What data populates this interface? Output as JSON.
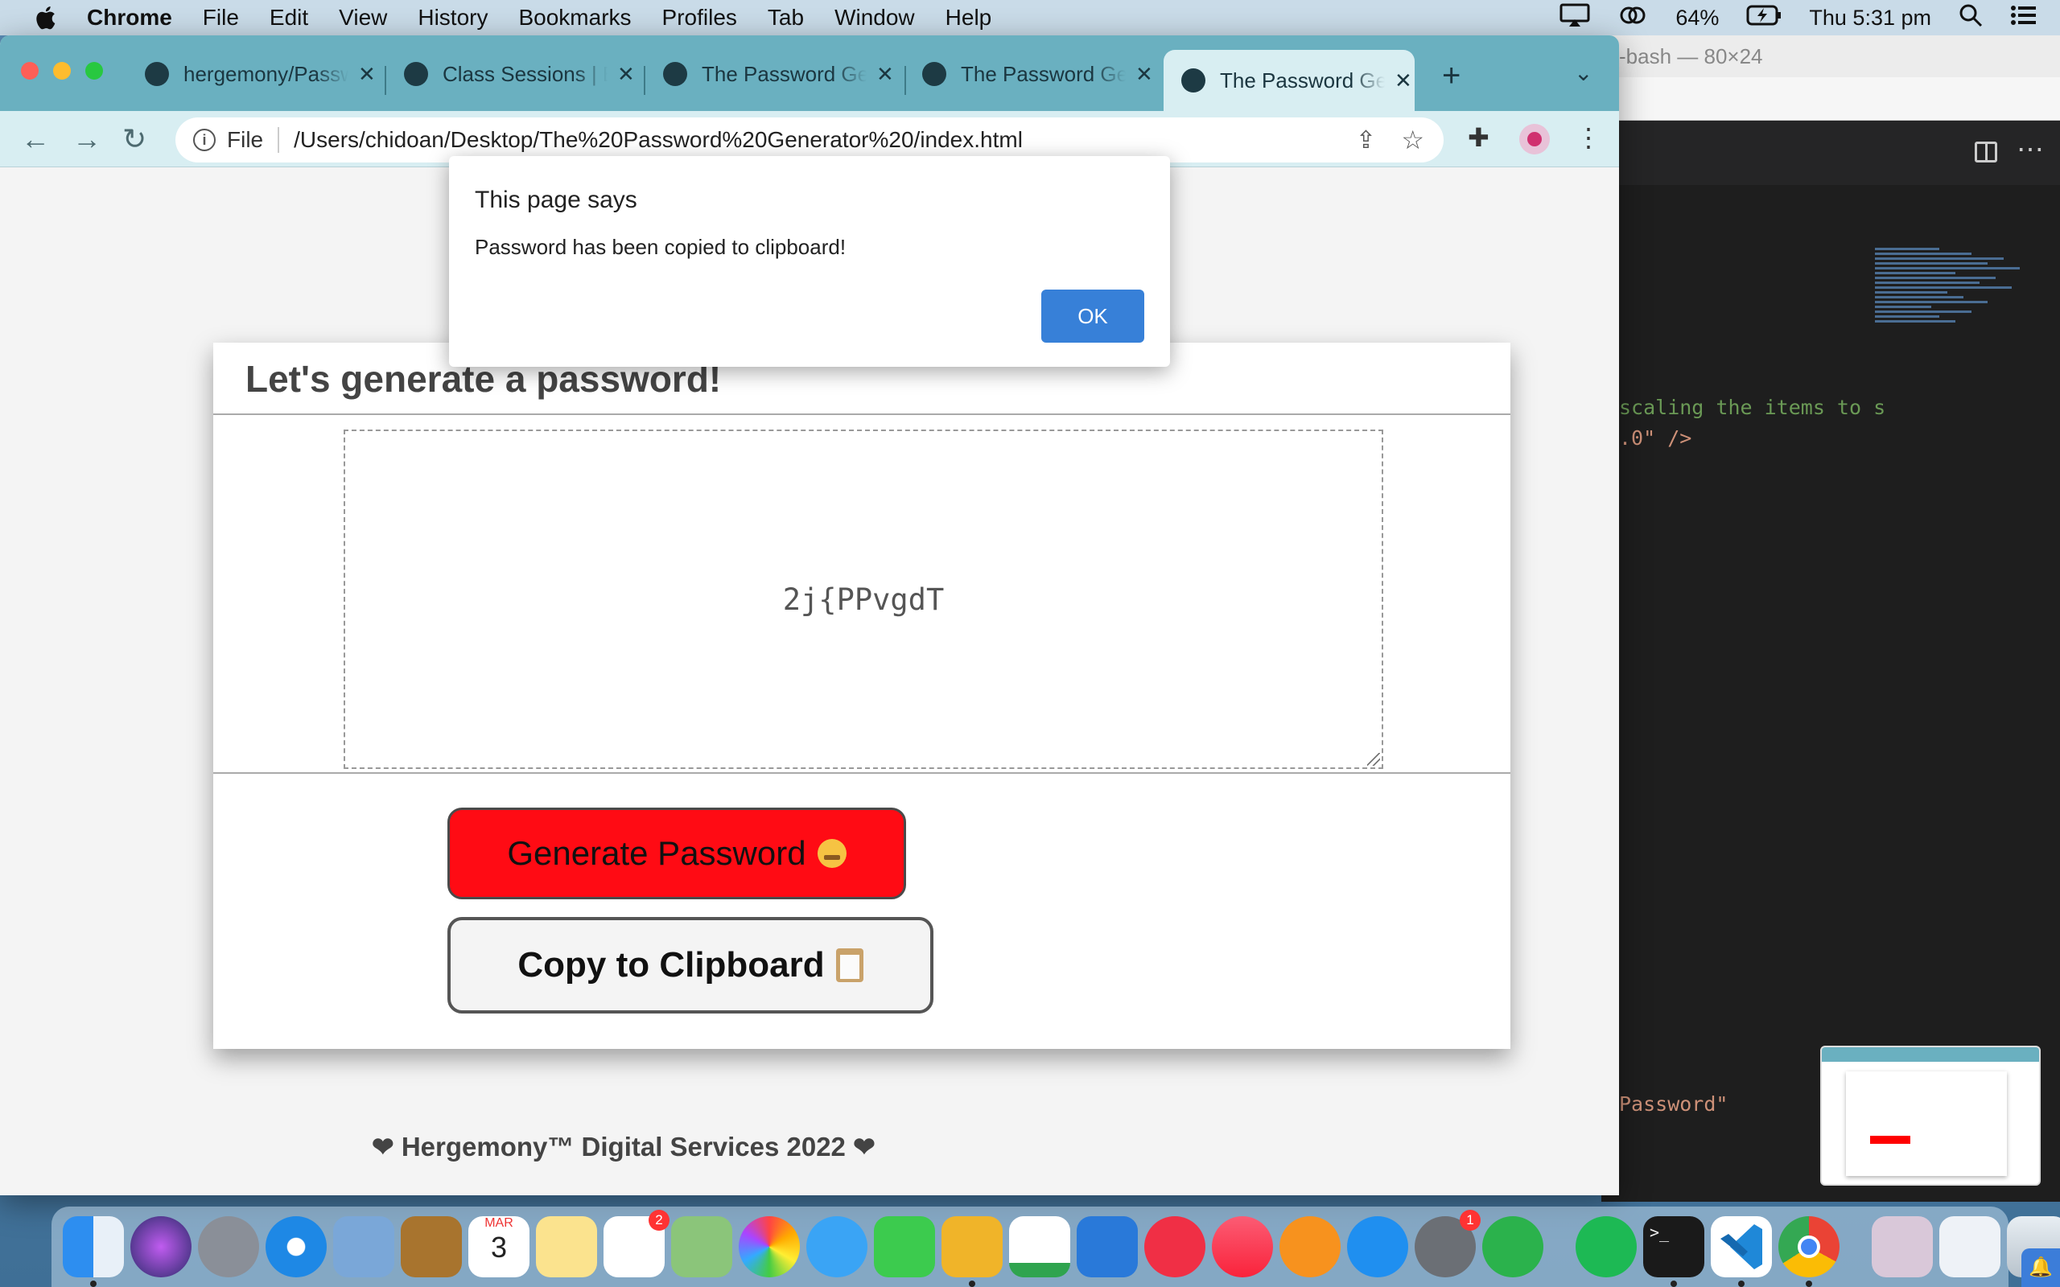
{
  "menubar": {
    "app_name": "Chrome",
    "items": [
      "File",
      "Edit",
      "View",
      "History",
      "Bookmarks",
      "Profiles",
      "Tab",
      "Window",
      "Help"
    ],
    "battery": "64%",
    "clock": "Thu 5:31 pm"
  },
  "terminal": {
    "title": "-bash — 80×24",
    "code_line_1": "scaling the items to s",
    "code_line_2": ".0\" />",
    "code_line_3": "Password\""
  },
  "tabs": [
    {
      "label": "hergemony/Password-Generator",
      "icon": "github-icon"
    },
    {
      "label": "Class Sessions | Bootcamp",
      "icon": "globe-icon"
    },
    {
      "label": "The Password Generator",
      "icon": "globe-icon"
    },
    {
      "label": "The Password Generator",
      "icon": "globe-icon"
    },
    {
      "label": "The Password Generator",
      "icon": "globe-icon",
      "active": true
    }
  ],
  "omnibox": {
    "scheme": "File",
    "url": "/Users/chidoan/Desktop/The%20Password%20Generator%20/index.html"
  },
  "page": {
    "header": "Let's generate a password!",
    "password": "2j{PPvgdT",
    "generate_label": "Generate Password",
    "copy_label": "Copy to Clipboard",
    "footer": "❤ Hergemony™ Digital Services 2022 ❤"
  },
  "alert": {
    "title": "This page says",
    "message": "Password has been copied to clipboard!",
    "ok_label": "OK"
  },
  "dock": {
    "calendar_month": "MAR",
    "calendar_day": "3",
    "reminders_badge": "2",
    "settings_badge": "1"
  },
  "colors": {
    "generate_button": "#ff0b14",
    "tabstrip": "#6ab0c0",
    "alert_ok": "#3780d8"
  }
}
